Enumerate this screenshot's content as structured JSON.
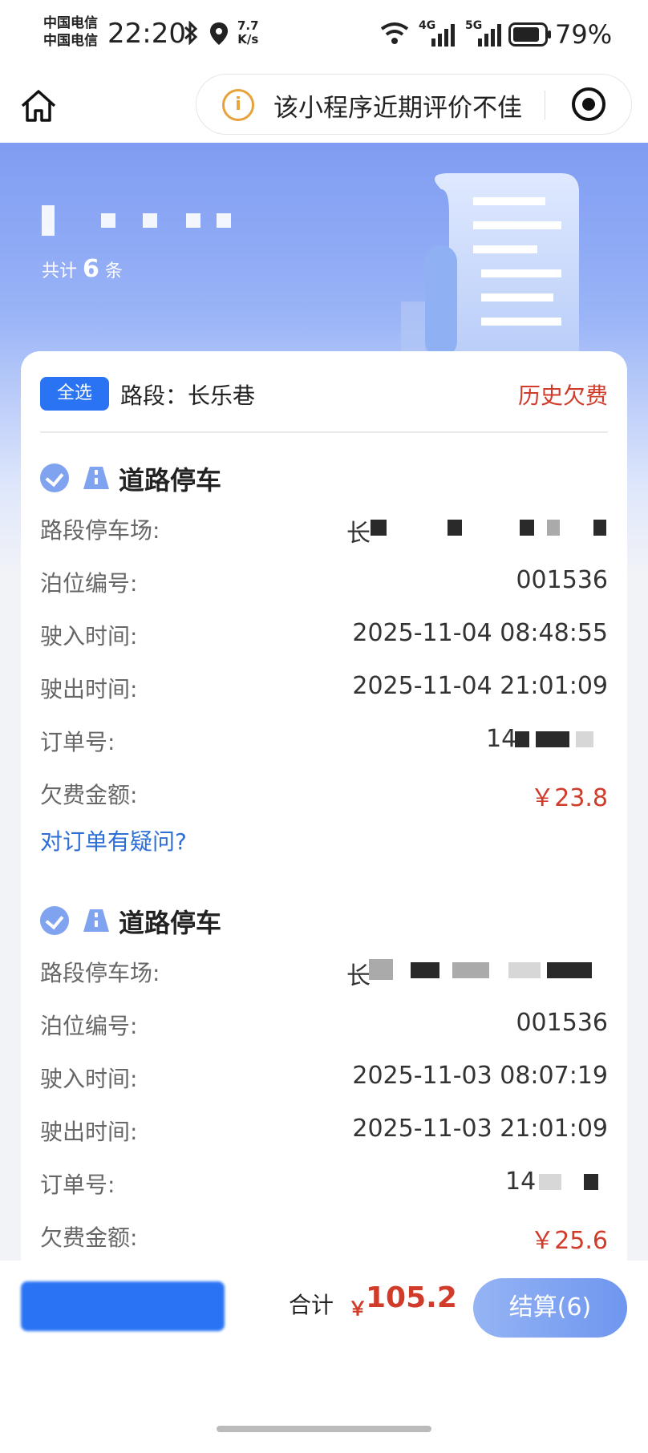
{
  "status_bar": {
    "carrier_1": "中国电信",
    "carrier_2": "中国电信",
    "time": "22:20",
    "net_speed_value": "7.7",
    "net_speed_unit": "K/s",
    "signal_1": "4G",
    "signal_2": "5G",
    "battery": "79%"
  },
  "nav": {
    "notice": "该小程序近期评价不佳",
    "warn_symbol": "i"
  },
  "header": {
    "count_prefix": "共计",
    "count": "6",
    "count_suffix": "条"
  },
  "card": {
    "select_all": "全选",
    "section_label": "路段：长乐巷",
    "history_link": "历史欠费"
  },
  "orders": [
    {
      "title": "道路停车",
      "rows": [
        {
          "key": "路段停车场:",
          "value": "长"
        },
        {
          "key": "泊位编号:",
          "value": "001536"
        },
        {
          "key": "驶入时间:",
          "value": "2025-11-04 08:48:55"
        },
        {
          "key": "驶出时间:",
          "value": "2025-11-04 21:01:09"
        },
        {
          "key": "订单号:",
          "value": "14"
        },
        {
          "key": "欠费金额:",
          "value": "￥23.8"
        }
      ],
      "doubt": "对订单有疑问?"
    },
    {
      "title": "道路停车",
      "rows": [
        {
          "key": "路段停车场:",
          "value": "长"
        },
        {
          "key": "泊位编号:",
          "value": "001536"
        },
        {
          "key": "驶入时间:",
          "value": "2025-11-03 08:07:19"
        },
        {
          "key": "驶出时间:",
          "value": "2025-11-03 21:01:09"
        },
        {
          "key": "订单号:",
          "value": "14"
        },
        {
          "key": "欠费金额:",
          "value": "￥25.6"
        }
      ]
    }
  ],
  "footer": {
    "total_label": "合计",
    "currency": "￥",
    "total": "105.2",
    "pay_button": "结算(6)"
  },
  "colors": {
    "primary": "#2a74f4",
    "danger": "#d13b2a",
    "link": "#2e6fd6"
  },
  "icons": [
    "home-icon",
    "warning-icon",
    "target-icon",
    "check-icon",
    "road-icon",
    "bluetooth-icon",
    "location-icon",
    "wifi-icon",
    "battery-icon"
  ]
}
